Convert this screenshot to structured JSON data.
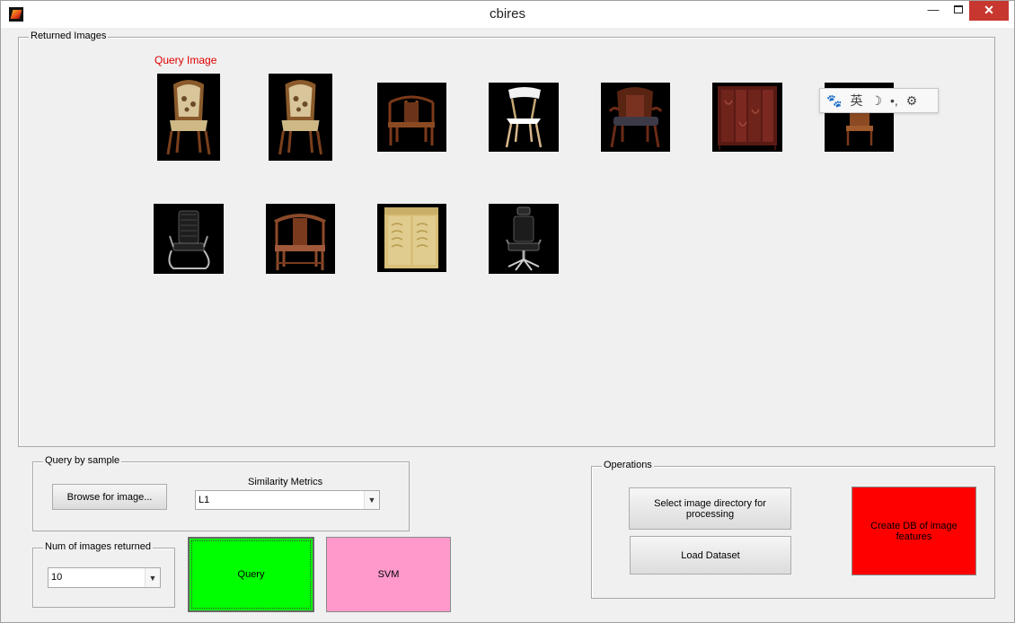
{
  "window": {
    "title": "cbires",
    "controls": {
      "minimize": "—",
      "close": "✕"
    }
  },
  "returned_panel": {
    "legend": "Returned Images",
    "query_label": "Query Image",
    "images": [
      {
        "subject": "ornate upholstered chair (query)"
      },
      {
        "subject": "ornate upholstered chair"
      },
      {
        "subject": "wooden armchair"
      },
      {
        "subject": "white modern chair"
      },
      {
        "subject": "carved wooden armchair"
      },
      {
        "subject": "red lacquer cabinet"
      },
      {
        "subject": "small wooden chair"
      },
      {
        "subject": "black mesh office chair"
      },
      {
        "subject": "ming style wooden armchair"
      },
      {
        "subject": "bamboo shoe cabinet"
      },
      {
        "subject": "black office chair with headrest"
      }
    ]
  },
  "ime_bar": {
    "paw": "🐾",
    "lang": "英",
    "moon": "☽",
    "punct": "•,",
    "settings": "⚙"
  },
  "query_panel": {
    "legend": "Query by sample",
    "browse_label": "Browse for image...",
    "metric_caption": "Similarity Metrics",
    "metric_value": "L1"
  },
  "num_panel": {
    "legend": "Num of images returned",
    "value": "10"
  },
  "actions": {
    "query_label": "Query",
    "svm_label": "SVM"
  },
  "operations": {
    "legend": "Operations",
    "select_dir_label": "Select image directory for processing",
    "load_label": "Load Dataset",
    "create_db_label": "Create DB of image features"
  },
  "colors": {
    "query_button": "#00ff00",
    "svm_button": "#ff99cc",
    "create_db_button": "#ff0000",
    "query_label": "#e00000"
  }
}
